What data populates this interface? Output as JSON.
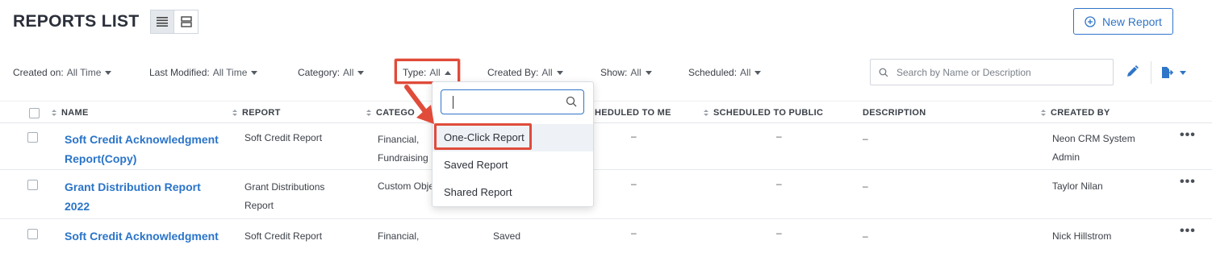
{
  "header": {
    "title": "REPORTS LIST",
    "new_report_label": "New Report"
  },
  "filters": [
    {
      "label": "Created on:",
      "value": "All Time"
    },
    {
      "label": "Last Modified:",
      "value": "All Time"
    },
    {
      "label": "Category:",
      "value": "All"
    },
    {
      "label": "Type:",
      "value": "All"
    },
    {
      "label": "Created By:",
      "value": "All"
    },
    {
      "label": "Show:",
      "value": "All"
    },
    {
      "label": "Scheduled:",
      "value": "All"
    }
  ],
  "search": {
    "placeholder": "Search by Name or Description",
    "value": ""
  },
  "columns": {
    "name": "NAME",
    "report": "REPORT",
    "category": "CATEGO",
    "scheduled_to_me": "HEDULED TO ME",
    "scheduled_to_public": "SCHEDULED TO PUBLIC",
    "description": "DESCRIPTION",
    "created_by": "CREATED BY"
  },
  "rows": [
    {
      "name_line1": "Soft Credit Acknowledgment",
      "name_line2": "Report(Copy)",
      "report_line1": "Soft Credit Report",
      "report_line2": "",
      "category_line1": "Financial,",
      "category_line2": "Fundraising",
      "type": "",
      "scheduled_to_me": "–",
      "scheduled_to_public": "–",
      "description": "–",
      "created_by_line1": "Neon CRM System",
      "created_by_line2": "Admin"
    },
    {
      "name_line1": "Grant Distribution Report",
      "name_line2": "2022",
      "report_line1": "Grant Distributions",
      "report_line2": "Report",
      "category_line1": "Custom Obje",
      "category_line2": "",
      "type": "",
      "scheduled_to_me": "–",
      "scheduled_to_public": "–",
      "description": "–",
      "created_by_line1": "Taylor Nilan",
      "created_by_line2": ""
    },
    {
      "name_line1": "Soft Credit Acknowledgment",
      "name_line2": "",
      "report_line1": "Soft Credit Report",
      "report_line2": "",
      "category_line1": "Financial,",
      "category_line2": "",
      "type": "Saved",
      "scheduled_to_me": "–",
      "scheduled_to_public": "–",
      "description": "–",
      "created_by_line1": "Nick Hillstrom",
      "created_by_line2": ""
    }
  ],
  "type_dropdown": {
    "search_value": "",
    "options": [
      "One-Click Report",
      "Saved Report",
      "Shared Report"
    ]
  },
  "more_glyph": "•••",
  "colors": {
    "accent": "#2f75c8",
    "highlight": "#e04b3a",
    "link": "#2a74c9"
  }
}
